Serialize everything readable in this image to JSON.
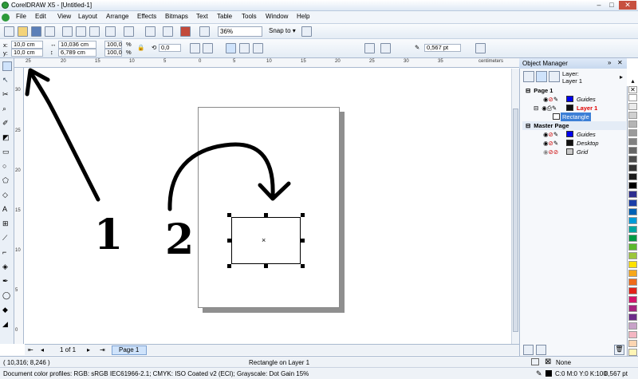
{
  "window": {
    "title": "CorelDRAW X5 - [Untitled-1]"
  },
  "menu": [
    "File",
    "Edit",
    "View",
    "Layout",
    "Arrange",
    "Effects",
    "Bitmaps",
    "Text",
    "Table",
    "Tools",
    "Window",
    "Help"
  ],
  "standard_toolbar": {
    "zoom": "36%",
    "snap_to": "Snap to"
  },
  "property_bar": {
    "x_label": "x:",
    "x_value": "10,0 cm",
    "y_label": "y:",
    "y_value": "10,0 cm",
    "width_value": "10,036 cm",
    "height_value": "6,789 cm",
    "scale_x": "100,0",
    "scale_y": "100,0",
    "percent": "%",
    "rotation": "0,0",
    "outline_width": "0,567 pt"
  },
  "ruler": {
    "h_ticks": [
      "25",
      "20",
      "15",
      "10",
      "5",
      "0",
      "5",
      "10",
      "15",
      "20",
      "25",
      "30",
      "35"
    ],
    "h_unit": "centimeters",
    "v_ticks": [
      "30",
      "25",
      "20",
      "15",
      "10",
      "5",
      "0"
    ],
    "v_unit": "centimeters"
  },
  "annotations": {
    "label_1": "1",
    "label_2": "2"
  },
  "page_nav": {
    "counter": "1 of 1",
    "tab": "Page 1"
  },
  "status": {
    "coords": "( 10,316; 8,246 )",
    "selection": "Rectangle on Layer 1",
    "profiles": "Document color profiles: RGB: sRGB IEC61966-2.1; CMYK: ISO Coated v2 (ECI); Grayscale: Dot Gain 15%",
    "fill": "None",
    "outline_color": "C:0 M:0 Y:0 K:100",
    "outline_width": "0,567 pt"
  },
  "object_manager": {
    "title": "Object Manager",
    "layer_label": "Layer:",
    "layer_name": "Layer 1",
    "tree": [
      {
        "text": "Page 1",
        "bold": true
      },
      {
        "text": "Guides"
      },
      {
        "text": "Layer 1",
        "red": true
      },
      {
        "text": "Rectangle",
        "selected": true
      },
      {
        "text": "Master Page",
        "bold": true
      },
      {
        "text": "Guides"
      },
      {
        "text": "Desktop"
      },
      {
        "text": "Grid"
      }
    ]
  },
  "palette_colors": [
    "#ffffff",
    "#eaeaea",
    "#d0d0d0",
    "#b5b5b5",
    "#9a9a9a",
    "#808080",
    "#666666",
    "#4d4d4d",
    "#333333",
    "#1a1a1a",
    "#000000",
    "#2e2e8f",
    "#1b3ea8",
    "#0061b5",
    "#009bd8",
    "#00a6a0",
    "#009a44",
    "#5cb82c",
    "#9cc63b",
    "#ffe100",
    "#f7a81b",
    "#ef6c1a",
    "#e2231a",
    "#d3156a",
    "#a6237f",
    "#6c2c8a",
    "#c8a2c8",
    "#f4b6c2",
    "#fdd5b1",
    "#fff5b5"
  ],
  "colors": {
    "accent": "#cfe3fb",
    "layer_red": "#e00000",
    "selection": "#3c7fd6"
  }
}
